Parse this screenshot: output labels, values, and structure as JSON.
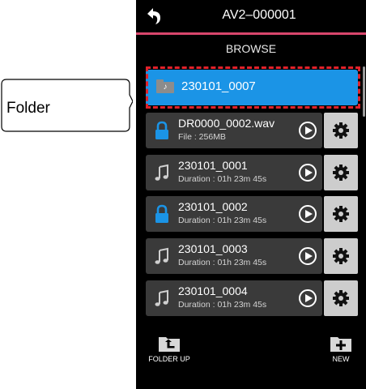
{
  "header": {
    "title": "AV2–000001",
    "section": "BROWSE"
  },
  "folder": {
    "name": "230101_0007",
    "icon": "music-folder-icon"
  },
  "files": [
    {
      "name": "DR0000_0002.wav",
      "info": "File : 256MB",
      "icon": "lock-icon",
      "icon_color": "#1b94e6"
    },
    {
      "name": "230101_0001",
      "info": "Duration : 01h 23m 45s",
      "icon": "music-note-icon",
      "icon_color": "#cfcfcf"
    },
    {
      "name": "230101_0002",
      "info": "Duration : 01h 23m 45s",
      "icon": "lock-icon",
      "icon_color": "#1b94e6"
    },
    {
      "name": "230101_0003",
      "info": "Duration : 01h 23m 45s",
      "icon": "music-note-icon",
      "icon_color": "#cfcfcf"
    },
    {
      "name": "230101_0004",
      "info": "Duration : 01h 23m 45s",
      "icon": "music-note-icon",
      "icon_color": "#cfcfcf"
    }
  ],
  "footer": {
    "folder_up": "FOLDER UP",
    "new": "NEW"
  },
  "callout": {
    "label": "Folder"
  },
  "colors": {
    "accent": "#1b94e6",
    "header_line": "#d8466c",
    "highlight": "#e0222b"
  }
}
